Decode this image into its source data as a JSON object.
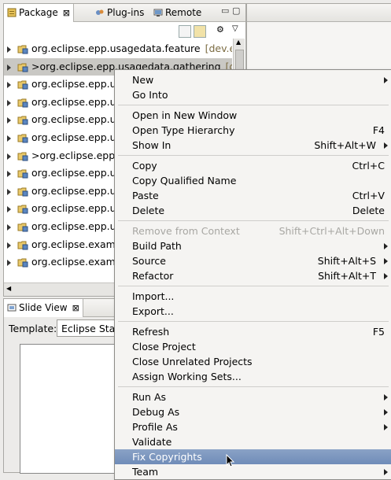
{
  "package_explorer": {
    "tabs": [
      {
        "label": "Package",
        "close": "⊠"
      },
      {
        "label": "Plug-ins"
      },
      {
        "label": "Remote"
      }
    ],
    "rows": [
      {
        "text": "org.eclipse.epp.usagedata.feature",
        "extra": "[dev.e"
      },
      {
        "text": ">org.eclipse.epp.usagedata.gathering",
        "extra": "[d"
      },
      {
        "text": "org.eclipse.epp.us",
        "extra": ""
      },
      {
        "text": "org.eclipse.epp.us",
        "extra": ""
      },
      {
        "text": "org.eclipse.epp.us",
        "extra": ""
      },
      {
        "text": "org.eclipse.epp.us",
        "extra": ""
      },
      {
        "text": ">org.eclipse.epp.u",
        "extra": ""
      },
      {
        "text": "org.eclipse.epp.us",
        "extra": ""
      },
      {
        "text": "org.eclipse.epp.us",
        "extra": ""
      },
      {
        "text": "org.eclipse.epp.us",
        "extra": ""
      },
      {
        "text": "org.eclipse.epp.us",
        "extra": ""
      },
      {
        "text": "org.eclipse.examp",
        "extra": ""
      },
      {
        "text": "org.eclipse.examp",
        "extra": ""
      }
    ],
    "selected_row": 1
  },
  "slide_view": {
    "tab_label": "Slide View",
    "close": "⊠",
    "template_label": "Template:",
    "template_value": "Eclipse Stan"
  },
  "context_menu": {
    "items": [
      {
        "label": "New",
        "accel": "",
        "submenu": true
      },
      {
        "label": "Go Into",
        "accel": ""
      },
      {
        "sep": true
      },
      {
        "label": "Open in New Window",
        "accel": ""
      },
      {
        "label": "Open Type Hierarchy",
        "accel": "F4"
      },
      {
        "label": "Show In",
        "accel": "Shift+Alt+W",
        "submenu": true
      },
      {
        "sep": true
      },
      {
        "label": "Copy",
        "accel": "Ctrl+C"
      },
      {
        "label": "Copy Qualified Name",
        "accel": ""
      },
      {
        "label": "Paste",
        "accel": "Ctrl+V"
      },
      {
        "label": "Delete",
        "accel": "Delete"
      },
      {
        "sep": true
      },
      {
        "label": "Remove from Context",
        "accel": "Shift+Ctrl+Alt+Down",
        "disabled": true
      },
      {
        "label": "Build Path",
        "accel": "",
        "submenu": true
      },
      {
        "label": "Source",
        "accel": "Shift+Alt+S",
        "submenu": true
      },
      {
        "label": "Refactor",
        "accel": "Shift+Alt+T",
        "submenu": true
      },
      {
        "sep": true
      },
      {
        "label": "Import...",
        "accel": ""
      },
      {
        "label": "Export...",
        "accel": ""
      },
      {
        "sep": true
      },
      {
        "label": "Refresh",
        "accel": "F5"
      },
      {
        "label": "Close Project",
        "accel": ""
      },
      {
        "label": "Close Unrelated Projects",
        "accel": ""
      },
      {
        "label": "Assign Working Sets...",
        "accel": ""
      },
      {
        "sep": true
      },
      {
        "label": "Run As",
        "accel": "",
        "submenu": true
      },
      {
        "label": "Debug As",
        "accel": "",
        "submenu": true
      },
      {
        "label": "Profile As",
        "accel": "",
        "submenu": true
      },
      {
        "label": "Validate",
        "accel": ""
      },
      {
        "label": "Fix Copyrights",
        "accel": "",
        "highlighted": true
      },
      {
        "label": "Team",
        "accel": "",
        "submenu": true
      }
    ]
  },
  "colors": {
    "menu_highlight": "#7b96c0",
    "selection": "#c9c8c4"
  }
}
